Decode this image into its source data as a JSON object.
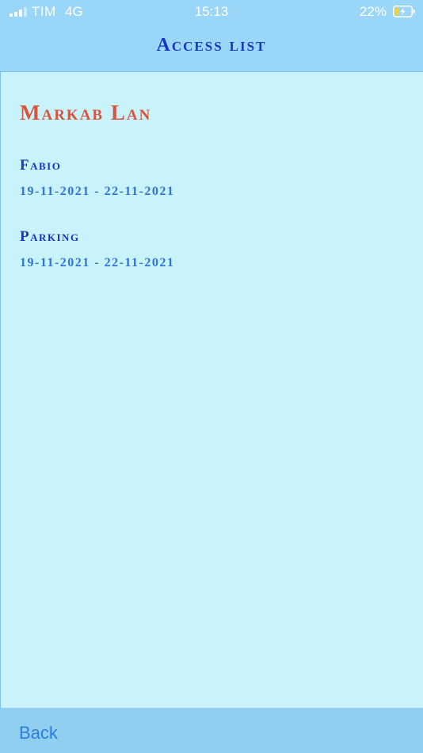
{
  "status_bar": {
    "carrier": "TIM",
    "network": "4G",
    "time": "15:13",
    "battery_percent": "22%",
    "battery_level": 0.22,
    "icons": [
      "signal-icon",
      "battery-charging-icon"
    ]
  },
  "header": {
    "title": "Access list"
  },
  "organization": {
    "name": "Markab Lan"
  },
  "access_items": [
    {
      "name": "Fabio",
      "dates": "19-11-2021 - 22-11-2021"
    },
    {
      "name": "Parking",
      "dates": "19-11-2021 - 22-11-2021"
    }
  ],
  "footer": {
    "back_label": "Back"
  },
  "colors": {
    "background": "#c8f3fb",
    "header_bg": "#99d6f7",
    "title": "#1a34c8",
    "org_name": "#d9533f",
    "dates": "#2f73d6",
    "back": "#2c7de0"
  }
}
